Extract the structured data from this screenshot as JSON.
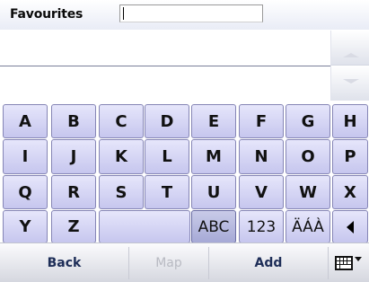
{
  "header": {
    "title": "Favourites",
    "search_value": ""
  },
  "keyboard": {
    "rows": [
      [
        "A",
        "B",
        "C",
        "D",
        "E",
        "F",
        "G",
        "H"
      ],
      [
        "I",
        "J",
        "K",
        "L",
        "M",
        "N",
        "O",
        "P"
      ],
      [
        "Q",
        "R",
        "S",
        "T",
        "U",
        "V",
        "W",
        "X"
      ]
    ],
    "row4_letters": [
      "Y",
      "Z"
    ],
    "modes": [
      "ABC",
      "123",
      "ÄÁÀ"
    ],
    "active_mode": "ABC"
  },
  "bottom_bar": {
    "back_label": "Back",
    "map_label": "Map",
    "add_label": "Add"
  },
  "icons": {
    "scroll_up": "chevron-up-icon",
    "scroll_down": "chevron-down-icon",
    "backspace": "backspace-icon",
    "keyboard": "keyboard-icon"
  }
}
